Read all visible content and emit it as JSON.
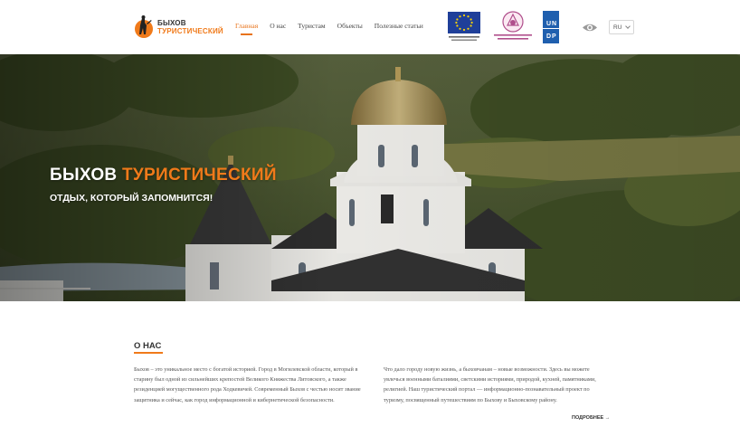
{
  "header": {
    "logo": {
      "line1": "БЫХОВ",
      "line2": "ТУРИСТИЧЕСКИЙ"
    },
    "nav": [
      {
        "label": "Главная",
        "active": true
      },
      {
        "label": "О нас",
        "active": false
      },
      {
        "label": "Туристам",
        "active": false
      },
      {
        "label": "Объекты",
        "active": false
      },
      {
        "label": "Полезные статьи",
        "active": false
      }
    ],
    "partners": [
      {
        "name": "eu-flag-icon",
        "caption": "Проект финансируется Европейским союзом"
      },
      {
        "name": "ministry-emblem-icon",
        "caption": "Министерство экономики Республики Беларусь"
      },
      {
        "name": "undp-logo-icon",
        "caption": "UNDP"
      }
    ],
    "language": "RU",
    "accessibility_icon": "eye-icon"
  },
  "hero": {
    "title_main": "БЫХОВ ",
    "title_accent": "ТУРИСТИЧЕСКИЙ",
    "subtitle": "ОТДЫХ, КОТОРЫЙ ЗАПОМНИТСЯ!"
  },
  "about": {
    "title": "О НАС",
    "left_text": "Быхов – это уникальное место с богатой историей. Город в Могилевской области, который в старину был одной из сильнейших крепостей Великого Княжества Литовского, а также резиденцией могущественного рода Ходкевичей. Современный Быхов с честью носит звание защитника и сейчас, как город информационной и кибернетической безопасности.",
    "right_text": "Что дало городу новую жизнь, а быховчанам – новые возможности. Здесь вы можете увлечься военными баталиями, светскими историями, природой, кухней, памятниками, религией. Наш туристический портал — информационно-познавательный проект по туризму, посвященный путешествиям по Быхову и Быховскому району.",
    "more_label": "ПОДРОБНЕЕ →"
  },
  "colors": {
    "accent": "#f07a1a",
    "text": "#333333"
  }
}
